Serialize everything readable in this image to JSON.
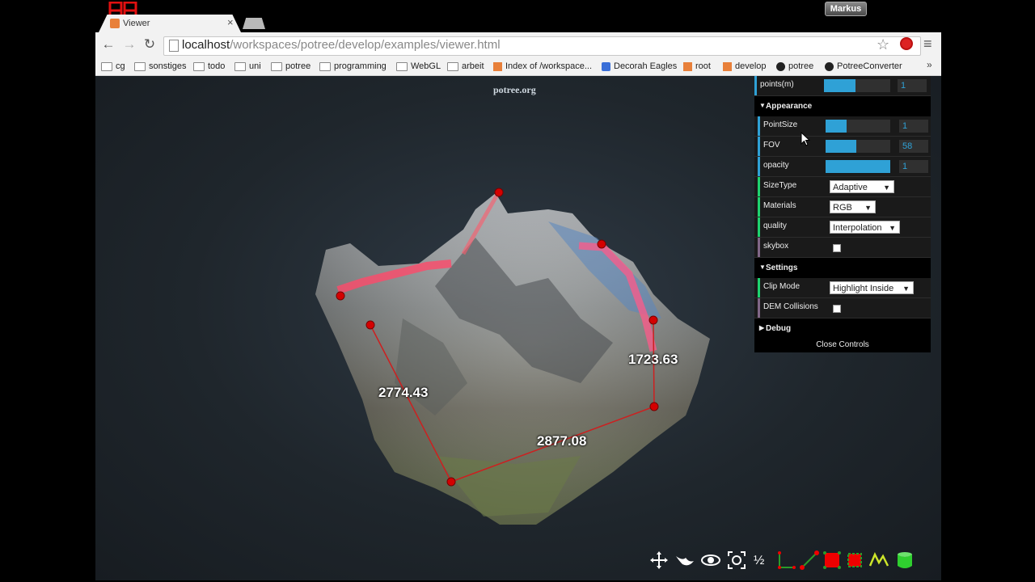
{
  "os": {
    "user_badge": "Markus",
    "corner_digits": "88"
  },
  "browser": {
    "tab_title": "Viewer",
    "tab_close": "×",
    "url_host": "localhost",
    "url_path": "/workspaces/potree/develop/examples/viewer.html",
    "nav": {
      "back": "←",
      "forward": "→",
      "reload": "↻",
      "star": "☆",
      "menu": "≡"
    },
    "bookmarks": [
      {
        "label": "cg",
        "icon": "folder-icon"
      },
      {
        "label": "sonstiges",
        "icon": "folder-icon"
      },
      {
        "label": "todo",
        "icon": "folder-icon"
      },
      {
        "label": "uni",
        "icon": "folder-icon"
      },
      {
        "label": "potree",
        "icon": "folder-icon"
      },
      {
        "label": "programming",
        "icon": "folder-icon"
      },
      {
        "label": "WebGL",
        "icon": "folder-icon"
      },
      {
        "label": "arbeit",
        "icon": "folder-icon"
      },
      {
        "label": "Index of /workspace...",
        "icon": "page-icon"
      },
      {
        "label": "Decorah Eagles",
        "icon": "ustream-icon"
      },
      {
        "label": "root",
        "icon": "page-icon"
      },
      {
        "label": "develop",
        "icon": "page-icon"
      },
      {
        "label": "potree",
        "icon": "github-icon"
      },
      {
        "label": "PotreeConverter",
        "icon": "github-icon"
      }
    ],
    "bookmarks_more": "»"
  },
  "viewer": {
    "site_link": "potree.org",
    "measurements": [
      "2774.43",
      "1723.63",
      "2877.08"
    ]
  },
  "controls": {
    "points_row": {
      "label": "points(m)",
      "value": "1",
      "fill": 0.48
    },
    "appearance": {
      "title": "Appearance",
      "point_size": {
        "label": "PointSize",
        "value": "1",
        "fill": 0.33
      },
      "fov": {
        "label": "FOV",
        "value": "58",
        "fill": 0.48
      },
      "opacity": {
        "label": "opacity",
        "value": "1",
        "fill": 1.0
      },
      "size_type": {
        "label": "SizeType",
        "selected": "Adaptive"
      },
      "materials": {
        "label": "Materials",
        "selected": "RGB"
      },
      "quality": {
        "label": "quality",
        "selected": "Interpolation"
      },
      "skybox": {
        "label": "skybox",
        "checked": false
      }
    },
    "settings": {
      "title": "Settings",
      "clip_mode": {
        "label": "Clip Mode",
        "selected": "Highlight Inside"
      },
      "dem_collisions": {
        "label": "DEM Collisions",
        "checked": false
      }
    },
    "debug": {
      "title": "Debug"
    },
    "close_label": "Close Controls"
  },
  "tools": [
    "move-icon",
    "fly-icon",
    "orbit-icon",
    "focus-icon",
    "half-icon",
    "angle-measure-icon",
    "distance-measure-icon",
    "point-measure-icon",
    "area-measure-icon",
    "height-profile-icon",
    "volume-icon"
  ],
  "colors": {
    "accent": "#2fa1d6",
    "marker": "#d40000",
    "line": "#cc2020"
  }
}
